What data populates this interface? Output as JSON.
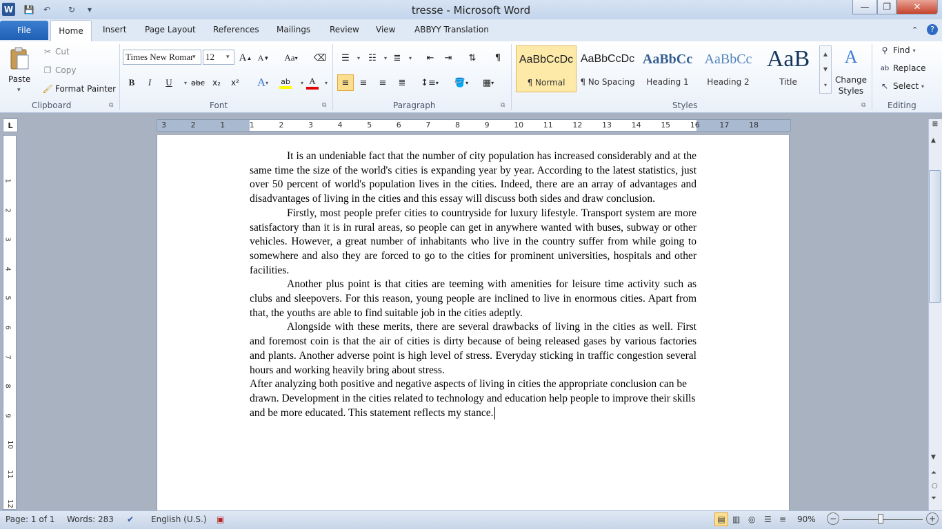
{
  "window": {
    "title": "tresse  -  Microsoft Word",
    "min": "—",
    "max": "❐",
    "close": "✕"
  },
  "qat": {
    "app_icon": "W",
    "save_icon": "💾",
    "undo_icon": "↶",
    "redo_icon": "↻",
    "customize_icon": "▾"
  },
  "tabs": {
    "file": "File",
    "items": [
      "Home",
      "Insert",
      "Page Layout",
      "References",
      "Mailings",
      "Review",
      "View",
      "ABBYY Translation"
    ]
  },
  "ribbon": {
    "clipboard": {
      "paste": "Paste",
      "cut": "Cut",
      "copy": "Copy",
      "format_painter": "Format Painter",
      "label": "Clipboard"
    },
    "font": {
      "name": "Times New Roman",
      "size": "12",
      "label": "Font",
      "grow": "A",
      "shrink": "A",
      "change_case": "Aa",
      "clear": "⌫",
      "bold": "B",
      "italic": "I",
      "underline": "U",
      "strike": "abc",
      "sub": "x₂",
      "sup": "x²",
      "highlight_color": "#ffff00",
      "font_color": "#e00000"
    },
    "paragraph": {
      "label": "Paragraph"
    },
    "styles": {
      "label": "Styles",
      "items": [
        {
          "preview": "AaBbCcDc",
          "name": "¶ Normal"
        },
        {
          "preview": "AaBbCcDc",
          "name": "¶ No Spacing"
        },
        {
          "preview": "AaBbCc",
          "name": "Heading 1"
        },
        {
          "preview": "AaBbCc",
          "name": "Heading 2"
        },
        {
          "preview": "AaB",
          "name": "Title"
        }
      ],
      "change_styles": "Change\nStyles"
    },
    "editing": {
      "find": "Find",
      "replace": "Replace",
      "select": "Select",
      "label": "Editing"
    }
  },
  "ruler": {
    "h_ticks": [
      "3",
      "2",
      "1",
      "1",
      "2",
      "3",
      "4",
      "5",
      "6",
      "7",
      "8",
      "9",
      "10",
      "11",
      "12",
      "13",
      "14",
      "15",
      "16",
      "17",
      "18"
    ],
    "v_ticks": [
      "1",
      "2",
      "3",
      "4",
      "5",
      "6",
      "7",
      "8",
      "9",
      "10",
      "11",
      "12"
    ],
    "tab_selector": "L"
  },
  "document": {
    "paragraphs": [
      "It is an undeniable fact that the number of city population has increased considerably and at the same time the size of the world's cities is expanding year by year. According to the latest statistics, just over 50 percent of world's population lives in the cities. Indeed, there are an array of advantages and disadvantages of living in the cities and this essay will discuss both sides and draw conclusion.",
      "Firstly, most people prefer cities to countryside for luxury lifestyle. Transport system are more satisfactory than it is in rural areas, so people can get in anywhere wanted with buses, subway or other vehicles. However, a great number of inhabitants who live in the country suffer from while going to somewhere and also they are forced to go to the cities for prominent universities, hospitals and other facilities.",
      "Another plus point is that cities are teeming with amenities for leisure time activity such as clubs and sleepovers. For this reason, young people are inclined to live in enormous cities. Apart from that, the youths are able to find suitable job in the cities adeptly.",
      "Alongside with these merits, there are several drawbacks of living in the cities as well. First and foremost coin is that the air of cities is dirty because of being released gases by various factories and plants. Another adverse point is high level of stress. Everyday sticking in traffic congestion several hours and working heavily bring about stress.",
      "After analyzing both positive and negative aspects of living in cities the appropriate conclusion can be drawn. Development in the cities related to technology and education help people to improve their skills and be more educated. This statement reflects my stance."
    ]
  },
  "status": {
    "page": "Page: 1 of 1",
    "words": "Words: 283",
    "language": "English (U.S.)",
    "zoom": "90%",
    "zoom_out": "−",
    "zoom_in": "+",
    "zoom_level": 0.47
  }
}
